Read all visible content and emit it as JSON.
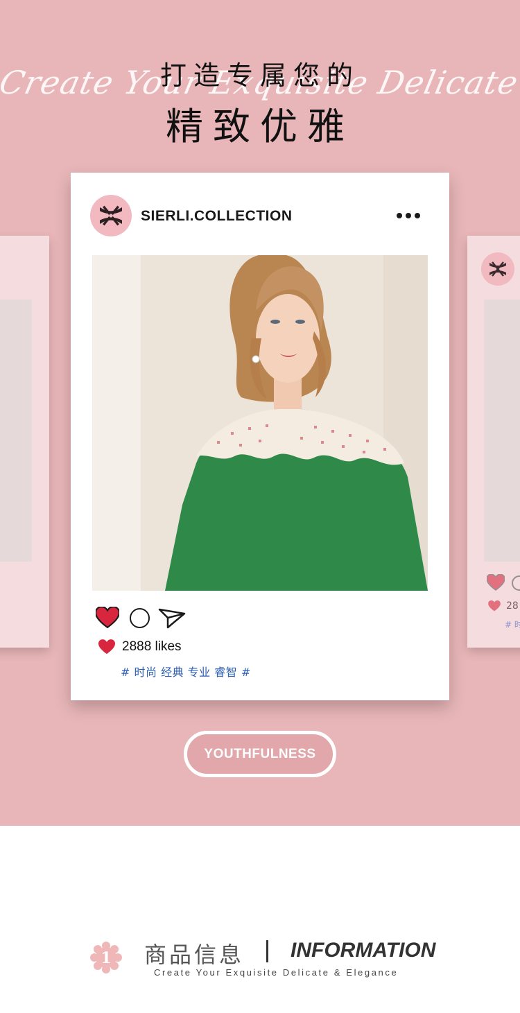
{
  "hero": {
    "script_text": "Create Your Exquisite Delicate & Elegance",
    "title_line_1": "打造专属您的",
    "title_line_2": "精致优雅"
  },
  "post": {
    "username": "SIERLI.COLLECTION",
    "likes": "2888 likes",
    "tags": "# 时尚 经典 专业 睿智 #"
  },
  "side_card_right": {
    "likes_partial": "28",
    "tags_partial": "# 时"
  },
  "badge": {
    "label": "YOUTHFULNESS"
  },
  "info": {
    "number": "1",
    "title_cn": "商品信息",
    "title_en": "INFORMATION",
    "subtitle": "Create Your Exquisite Delicate & Elegance"
  },
  "colors": {
    "hero_bg": "#e8b6b8",
    "heart_red": "#d7263d",
    "tag_blue": "#2d5fb3",
    "pill_bg": "#e1a7aa"
  },
  "icons": [
    "sierli-logo-icon",
    "more-dots-icon",
    "heart-icon",
    "comment-icon",
    "send-icon",
    "flower-badge-icon"
  ]
}
